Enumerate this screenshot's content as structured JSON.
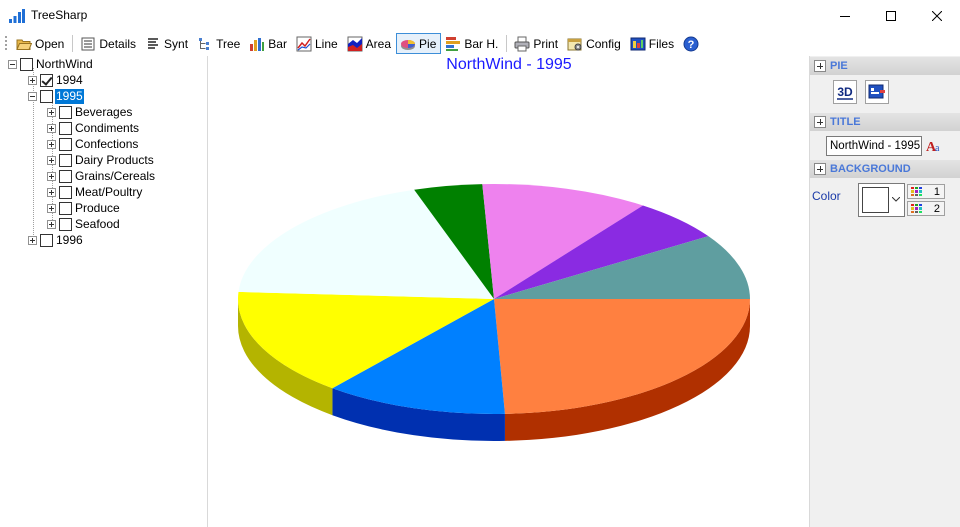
{
  "window": {
    "title": "TreeSharp"
  },
  "toolbar": {
    "open": "Open",
    "details": "Details",
    "synt": "Synt",
    "tree": "Tree",
    "bar": "Bar",
    "line": "Line",
    "area": "Area",
    "pie": "Pie",
    "barh": "Bar H.",
    "print": "Print",
    "config": "Config",
    "files": "Files",
    "active": "Pie"
  },
  "tree": {
    "root": "NorthWind",
    "years": [
      {
        "label": "1994",
        "checked": true
      },
      {
        "label": "1995",
        "checked": false,
        "selected": true
      },
      {
        "label": "1996",
        "checked": false
      }
    ],
    "categories": [
      "Beverages",
      "Condiments",
      "Confections",
      "Dairy Products",
      "Grains/Cereals",
      "Meat/Poultry",
      "Produce",
      "Seafood"
    ]
  },
  "chart": {
    "title": "NorthWind - 1995"
  },
  "chart_data": {
    "type": "pie",
    "title": "NorthWind - 1995",
    "style": "3d",
    "start_angle_deg": 0,
    "slices": [
      {
        "value": 25.9,
        "color": "#ff8040",
        "side": "#b03000"
      },
      {
        "value": 12.3,
        "color": "#0080ff",
        "side": "#0030b0"
      },
      {
        "value": 16.1,
        "color": "#ffff00",
        "side": "#b4b400"
      },
      {
        "value": 20.2,
        "color": "#f0ffff",
        "side": "#d0dada"
      },
      {
        "value": 4.6,
        "color": "#008000",
        "side": "#005000"
      },
      {
        "value": 11.3,
        "color": "#ee82ee",
        "side": "#a050a0"
      },
      {
        "value": 6.3,
        "color": "#8a2be2",
        "side": "#5a1aa0"
      },
      {
        "value": 9.8,
        "color": "#5f9ea0",
        "side": "#3d6e70"
      }
    ]
  },
  "panel": {
    "pie_head": "PIE",
    "title_head": "TITLE",
    "title_value": "NorthWind - 1995",
    "background_head": "BACKGROUND",
    "color_label": "Color",
    "color1": "1",
    "color2": "2"
  }
}
